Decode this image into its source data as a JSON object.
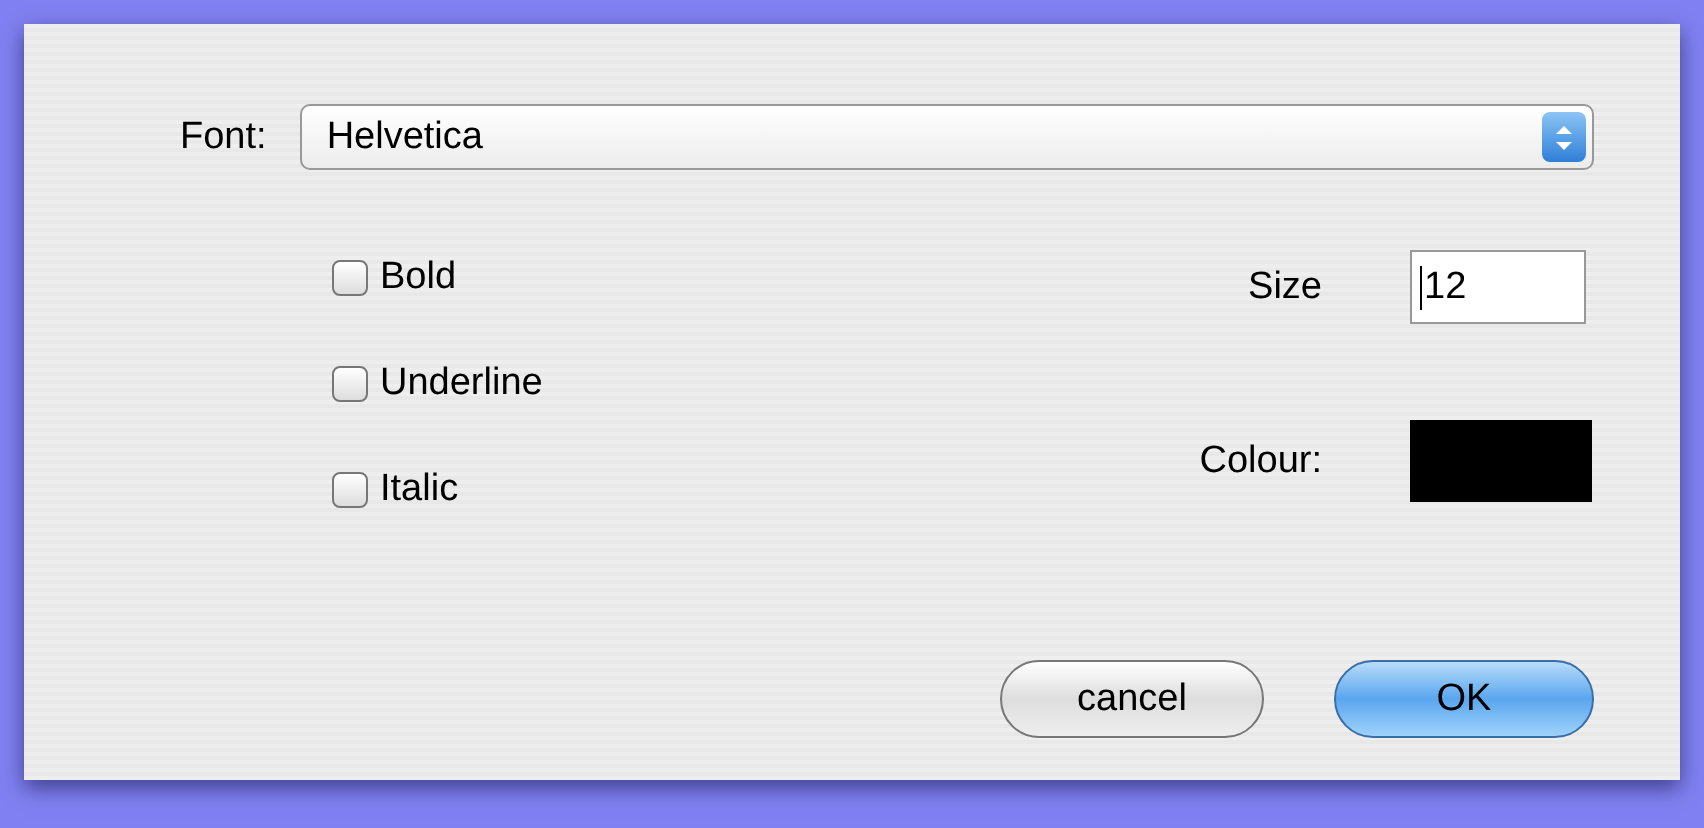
{
  "font": {
    "label": "Font:",
    "value": "Helvetica"
  },
  "checkboxes": [
    {
      "label": "Bold",
      "checked": false
    },
    {
      "label": "Underline",
      "checked": false
    },
    {
      "label": "Italic",
      "checked": false
    }
  ],
  "size": {
    "label": "Size",
    "value": "12"
  },
  "colour": {
    "label": "Colour:",
    "color": "#000000"
  },
  "buttons": [
    {
      "label": "cancel",
      "kind": "secondary"
    },
    {
      "label": "OK",
      "kind": "default"
    }
  ]
}
